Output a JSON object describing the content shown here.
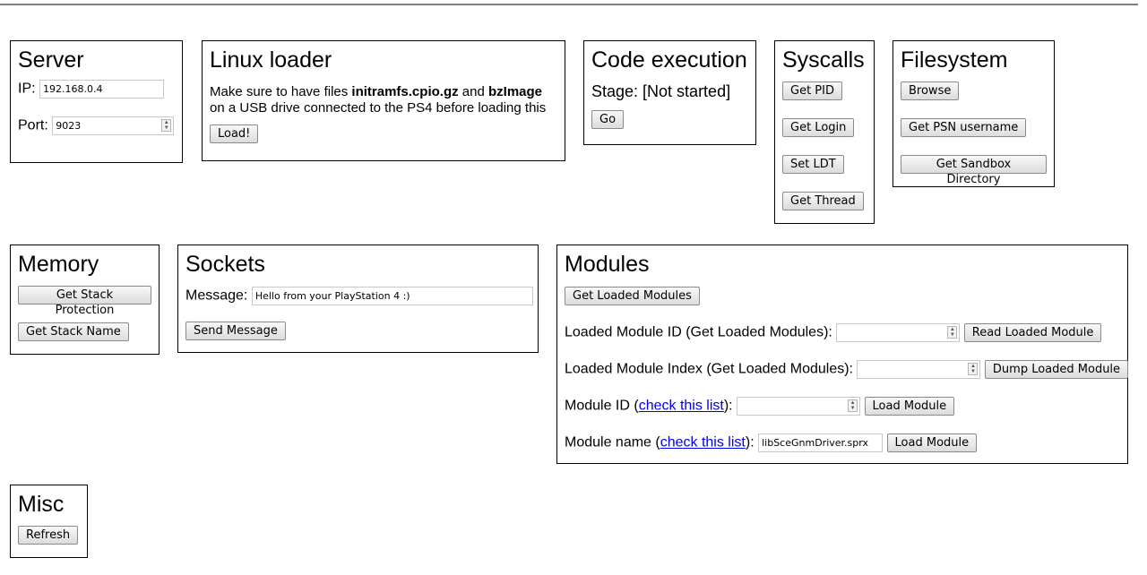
{
  "server": {
    "title": "Server",
    "ip_label": "IP:",
    "ip_value": "192.168.0.4",
    "port_label": "Port:",
    "port_value": "9023"
  },
  "linux": {
    "title": "Linux loader",
    "text_1": "Make sure to have files ",
    "file_1": "initramfs.cpio.gz",
    "text_and": " and ",
    "file_2": "bzImage",
    "text_2": "on a USB drive connected to the PS4 before loading this",
    "load_button": "Load!"
  },
  "code": {
    "title": "Code execution",
    "stage": "Stage: [Not started]",
    "go_button": "Go"
  },
  "syscalls": {
    "title": "Syscalls",
    "buttons": [
      "Get PID",
      "Get Login",
      "Set LDT",
      "Get Thread"
    ]
  },
  "filesystem": {
    "title": "Filesystem",
    "buttons": [
      "Browse",
      "Get PSN username",
      "Get Sandbox Directory"
    ]
  },
  "memory": {
    "title": "Memory",
    "buttons": [
      "Get Stack Protection",
      "Get Stack Name"
    ]
  },
  "sockets": {
    "title": "Sockets",
    "message_label": "Message:",
    "message_value": "Hello from your PlayStation 4 :)",
    "send_button": "Send Message"
  },
  "modules": {
    "title": "Modules",
    "get_loaded_button": "Get Loaded Modules",
    "loaded_id_label": "Loaded Module ID (Get Loaded Modules):",
    "read_loaded_button": "Read Loaded Module",
    "loaded_index_label": "Loaded Module Index (Get Loaded Modules):",
    "dump_loaded_button": "Dump Loaded Module",
    "module_id_prefix": "Module ID (",
    "module_id_link": "check this list",
    "module_id_suffix": "):",
    "load_module_button": "Load Module",
    "module_name_prefix": "Module name (",
    "module_name_link": "check this list",
    "module_name_suffix": "):",
    "module_name_value": "libSceGnmDriver.sprx",
    "load_module_button_2": "Load Module"
  },
  "misc": {
    "title": "Misc",
    "refresh_button": "Refresh"
  }
}
